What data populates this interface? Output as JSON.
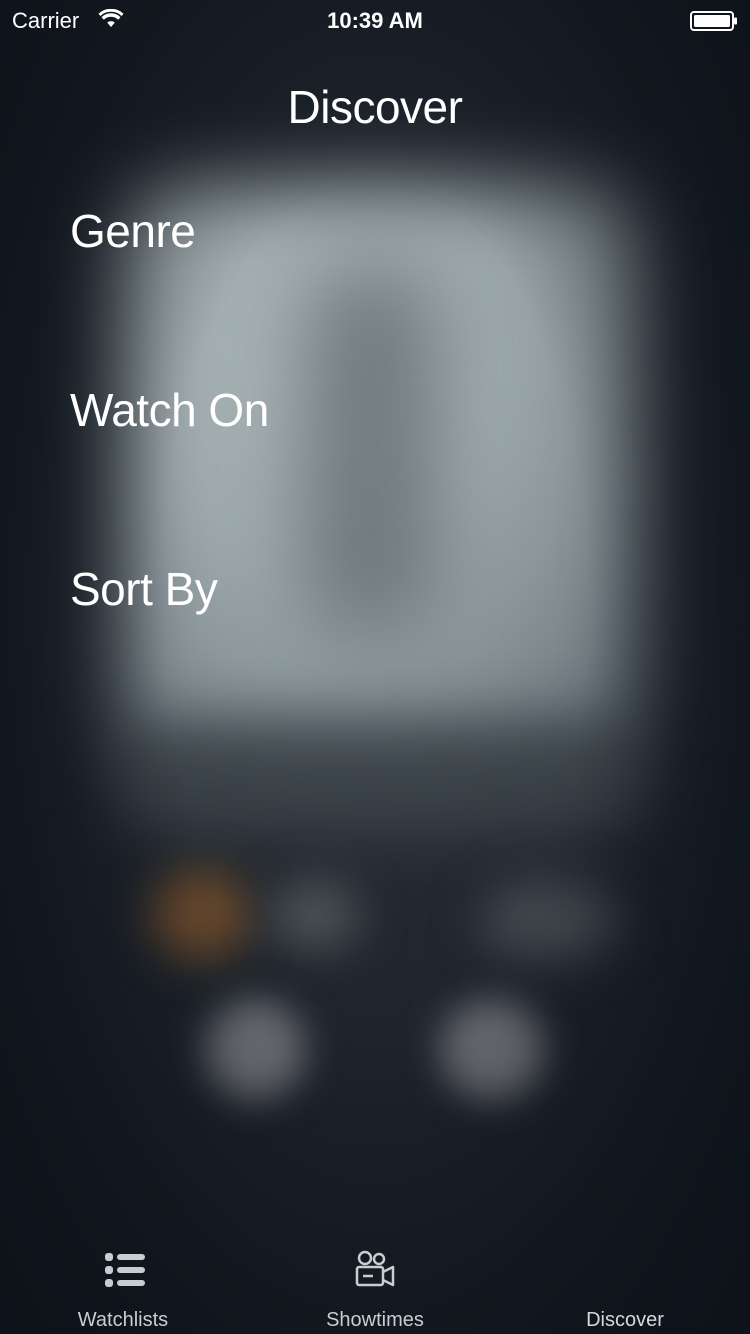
{
  "status_bar": {
    "carrier": "Carrier",
    "time": "10:39 AM"
  },
  "header": {
    "title": "Discover"
  },
  "menu": {
    "items": [
      {
        "label": "Genre"
      },
      {
        "label": "Watch On"
      },
      {
        "label": "Sort By"
      }
    ]
  },
  "tab_bar": {
    "tabs": [
      {
        "label": "Watchlists",
        "icon": "list-icon"
      },
      {
        "label": "Showtimes",
        "icon": "movie-camera-icon"
      },
      {
        "label": "Discover",
        "icon": "none"
      }
    ],
    "selected": "Discover"
  },
  "colors": {
    "text": "#ffffff",
    "tab_label": "#c9ccd0",
    "background_dark": "#141a22"
  }
}
